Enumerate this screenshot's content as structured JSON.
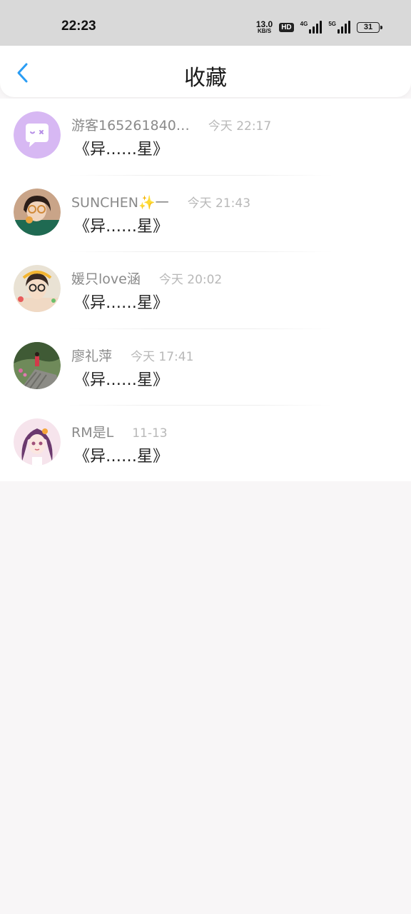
{
  "status_bar": {
    "time": "22:23",
    "net_speed_value": "13.0",
    "net_speed_unit": "KB/S",
    "hd_label": "HD",
    "signal_1_label": "4G",
    "signal_2_label": "5G",
    "battery_level": "31"
  },
  "header": {
    "title": "收藏",
    "back_icon": "chevron-left-icon",
    "accent_color": "#2a9df4"
  },
  "favorites": [
    {
      "username": "游客165261840…",
      "time": "今天 22:17",
      "content": "《异……星》",
      "avatar": "chat-bubble-avatar"
    },
    {
      "username": "SUNCHEN✨一",
      "time": "今天 21:43",
      "content": "《异……星》",
      "avatar": "photo-avatar"
    },
    {
      "username": "媛只love涵",
      "time": "今天 20:02",
      "content": "《异……星》",
      "avatar": "photo-avatar"
    },
    {
      "username": "廖礼萍",
      "time": "今天 17:41",
      "content": "《异……星》",
      "avatar": "photo-avatar"
    },
    {
      "username": "RM是L",
      "time": "11-13",
      "content": "《异……星》",
      "avatar": "anime-avatar"
    }
  ]
}
